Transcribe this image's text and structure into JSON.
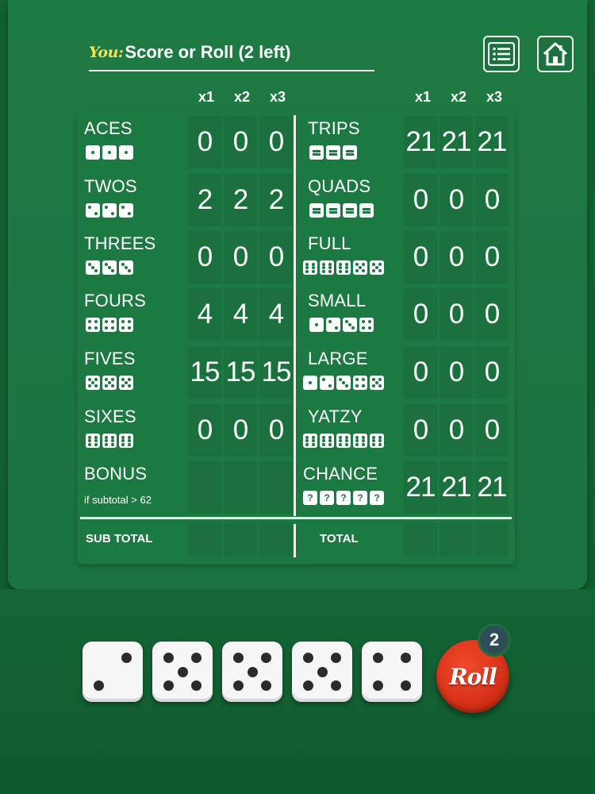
{
  "header": {
    "you_label": "You:",
    "status": "Score or Roll (2 left)",
    "menu_icon": "list-icon",
    "home_icon": "home-icon"
  },
  "column_headers": [
    "x1",
    "x2",
    "x3"
  ],
  "left_rows": [
    {
      "label": "ACES",
      "dice": [
        "1",
        "1",
        "1"
      ],
      "scores": [
        "0",
        "0",
        "0"
      ]
    },
    {
      "label": "TWOS",
      "dice": [
        "2",
        "2",
        "2"
      ],
      "scores": [
        "2",
        "2",
        "2"
      ]
    },
    {
      "label": "THREES",
      "dice": [
        "3",
        "3",
        "3"
      ],
      "scores": [
        "0",
        "0",
        "0"
      ]
    },
    {
      "label": "FOURS",
      "dice": [
        "4",
        "4",
        "4"
      ],
      "scores": [
        "4",
        "4",
        "4"
      ]
    },
    {
      "label": "FIVES",
      "dice": [
        "5",
        "5",
        "5"
      ],
      "scores": [
        "15",
        "15",
        "15"
      ]
    },
    {
      "label": "SIXES",
      "dice": [
        "6",
        "6",
        "6"
      ],
      "scores": [
        "0",
        "0",
        "0"
      ]
    },
    {
      "label": "BONUS",
      "sub": "if subtotal > 62",
      "dice": [],
      "scores": [
        "",
        "",
        ""
      ]
    }
  ],
  "right_rows": [
    {
      "label": "TRIPS",
      "dice": [
        "=",
        "=",
        "="
      ],
      "scores": [
        "21",
        "21",
        "21"
      ]
    },
    {
      "label": "QUADS",
      "dice": [
        "=",
        "=",
        "=",
        "="
      ],
      "scores": [
        "0",
        "0",
        "0"
      ]
    },
    {
      "label": "FULL",
      "dice": [
        "6",
        "6",
        "6",
        "5",
        "5"
      ],
      "scores": [
        "0",
        "0",
        "0"
      ]
    },
    {
      "label": "SMALL",
      "dice": [
        "1",
        "2",
        "3",
        "4"
      ],
      "scores": [
        "0",
        "0",
        "0"
      ]
    },
    {
      "label": "LARGE",
      "dice": [
        "1",
        "2",
        "3",
        "4",
        "5"
      ],
      "scores": [
        "0",
        "0",
        "0"
      ]
    },
    {
      "label": "YATZY",
      "dice": [
        "6",
        "6",
        "6",
        "6",
        "6"
      ],
      "scores": [
        "0",
        "0",
        "0"
      ]
    },
    {
      "label": "CHANCE",
      "dice": [
        "?",
        "?",
        "?",
        "?",
        "?"
      ],
      "scores": [
        "21",
        "21",
        "21"
      ]
    }
  ],
  "totals": {
    "sub_total_label": "SUB TOTAL",
    "total_label": "TOTAL"
  },
  "dice": [
    2,
    5,
    5,
    5,
    4
  ],
  "roll": {
    "label": "Roll",
    "rolls_left": "2"
  },
  "colors": {
    "felt": "#1c7942",
    "accent_yellow": "#f2e35a",
    "roll_red": "#d9331a"
  }
}
